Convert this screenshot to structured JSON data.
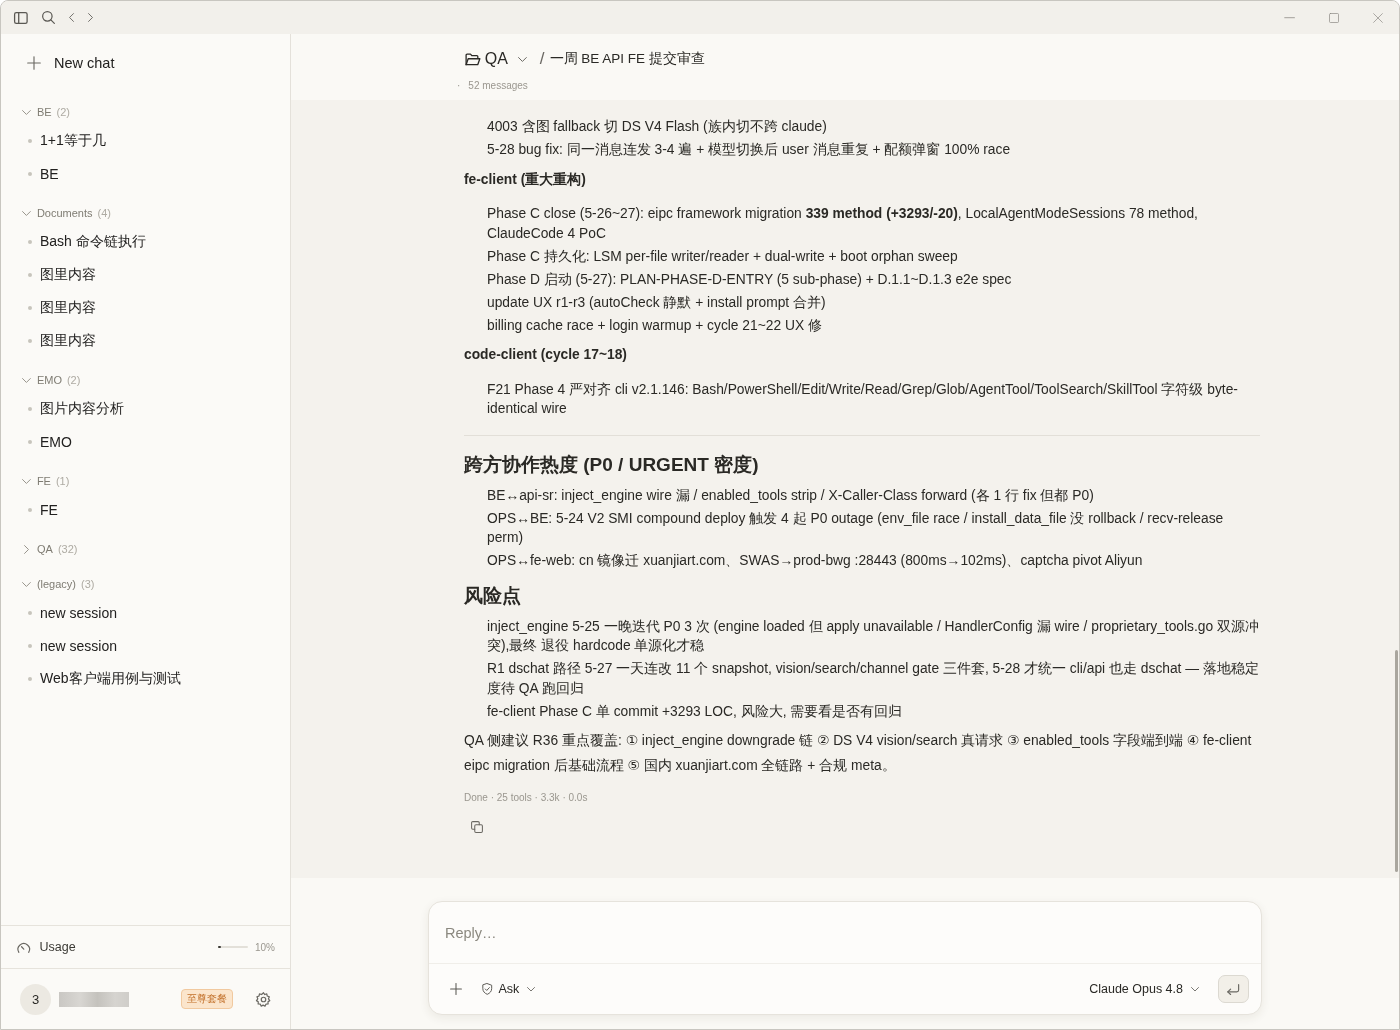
{
  "sidebar": {
    "new_chat": "New chat",
    "groups": [
      {
        "name": "BE",
        "count": "(2)",
        "expanded": true,
        "items": [
          {
            "title": "1+1等于几",
            "selected": false
          },
          {
            "title": "BE",
            "selected": false
          }
        ]
      },
      {
        "name": "Documents",
        "count": "(4)",
        "expanded": true,
        "items": [
          {
            "title": "Bash 命令链执行",
            "selected": false
          },
          {
            "title": "图里内容",
            "selected": false
          },
          {
            "title": "图里内容",
            "selected": false
          },
          {
            "title": "图里内容",
            "selected": false
          }
        ]
      },
      {
        "name": "EMO",
        "count": "(2)",
        "expanded": true,
        "items": [
          {
            "title": "图片内容分析",
            "selected": false
          },
          {
            "title": "EMO",
            "selected": false
          }
        ]
      },
      {
        "name": "FE",
        "count": "(1)",
        "expanded": true,
        "items": [
          {
            "title": "FE",
            "selected": false
          }
        ]
      },
      {
        "name": "QA",
        "count": "(32)",
        "expanded": false
      },
      {
        "name": "(legacy)",
        "count": "(3)",
        "expanded": true,
        "items": [
          {
            "title": "new session",
            "selected": false
          },
          {
            "title": "new session",
            "selected": false
          },
          {
            "title": "Web客户端用例与测试",
            "selected": false
          }
        ]
      }
    ],
    "usage": {
      "label": "Usage",
      "level": 0.1,
      "reading": "10%"
    },
    "account": {
      "avatar": "3",
      "plan": "至尊套餐"
    }
  },
  "header": {
    "project": "QA",
    "separator": "/",
    "title": "一周 BE API FE 提交审查",
    "meta_separator": "·",
    "message_count": "52 messages"
  },
  "message": {
    "blocks": [
      {
        "kind": "list",
        "items": [
          "4003 含图 fallback 切 DS V4 Flash (族内切不跨 claude)",
          "5-28 bug fix: 同一消息连发 3-4 遍 + 模型切换后 user 消息重复 + 配额弹窗 100% race"
        ]
      },
      {
        "kind": "subheading",
        "text": "fe-client (重大重构)"
      },
      {
        "kind": "list",
        "items": [
          "Phase C close (5-26~27): eipc framework migration **339 method (+3293/-20)**, LocalAgentModeSessions 78 method, ClaudeCode 4 PoC",
          "Phase C 持久化: LSM per-file writer/reader + dual-write + boot orphan sweep",
          "Phase D 启动 (5-27): PLAN-PHASE-D-ENTRY (5 sub-phase) + D.1.1~D.1.3 e2e spec",
          "update UX r1-r3 (autoCheck 静默 + install prompt 合并)",
          "billing cache race + login warmup + cycle 21~22 UX 修"
        ]
      },
      {
        "kind": "subheading",
        "text": "code-client (cycle 17~18)"
      },
      {
        "kind": "list",
        "items": [
          "F21 Phase 4 严对齐 cli v2.1.146: Bash/PowerShell/Edit/Write/Read/Grep/Glob/AgentTool/ToolSearch/SkillTool 字符级 byte-identical wire"
        ]
      },
      {
        "kind": "rule"
      },
      {
        "kind": "heading",
        "text": "跨方协作热度 (P0 / URGENT 密度)"
      },
      {
        "kind": "list",
        "items": [
          "BE↔api-sr: inject_engine wire 漏 / enabled_tools strip / X-Caller-Class forward (各 1 行 fix 但都 P0)",
          "OPS↔BE: 5-24 V2 SMI compound deploy 触发 4 起 P0 outage (env_file race / install_data_file 没 rollback / recv-release perm)",
          "OPS↔fe-web: cn 镜像迁 xuanjiart.com、SWAS→prod-bwg :28443 (800ms→102ms)、captcha pivot Aliyun"
        ]
      },
      {
        "kind": "heading",
        "text": "风险点"
      },
      {
        "kind": "list",
        "items": [
          "inject_engine 5-25 一晚迭代 P0 3 次 (engine loaded 但 apply unavailable / HandlerConfig 漏 wire / proprietary_tools.go 双源冲突),最终 退役 hardcode 单源化才稳",
          "R1 dschat 路径 5-27 一天连改 11 个 snapshot, vision/search/channel gate 三件套, 5-28 才统一 cli/api 也走 dschat — 落地稳定度待 QA 跑回归",
          "fe-client Phase C 单 commit +3293 LOC, 风险大, 需要看是否有回归"
        ]
      },
      {
        "kind": "paragraph",
        "text": "QA 侧建议 R36 重点覆盖: ① inject_engine downgrade 链 ② DS V4 vision/search 真请求 ③ enabled_tools 字段端到端 ④ fe-client eipc migration 后基础流程 ⑤ 国内 xuanjiart.com 全链路 + 合规 meta。"
      }
    ],
    "status": "Done · 25 tools · 3.3k · 0.0s"
  },
  "composer": {
    "placeholder": "Reply…",
    "mode": "Ask",
    "model": "Claude Opus 4.8"
  }
}
